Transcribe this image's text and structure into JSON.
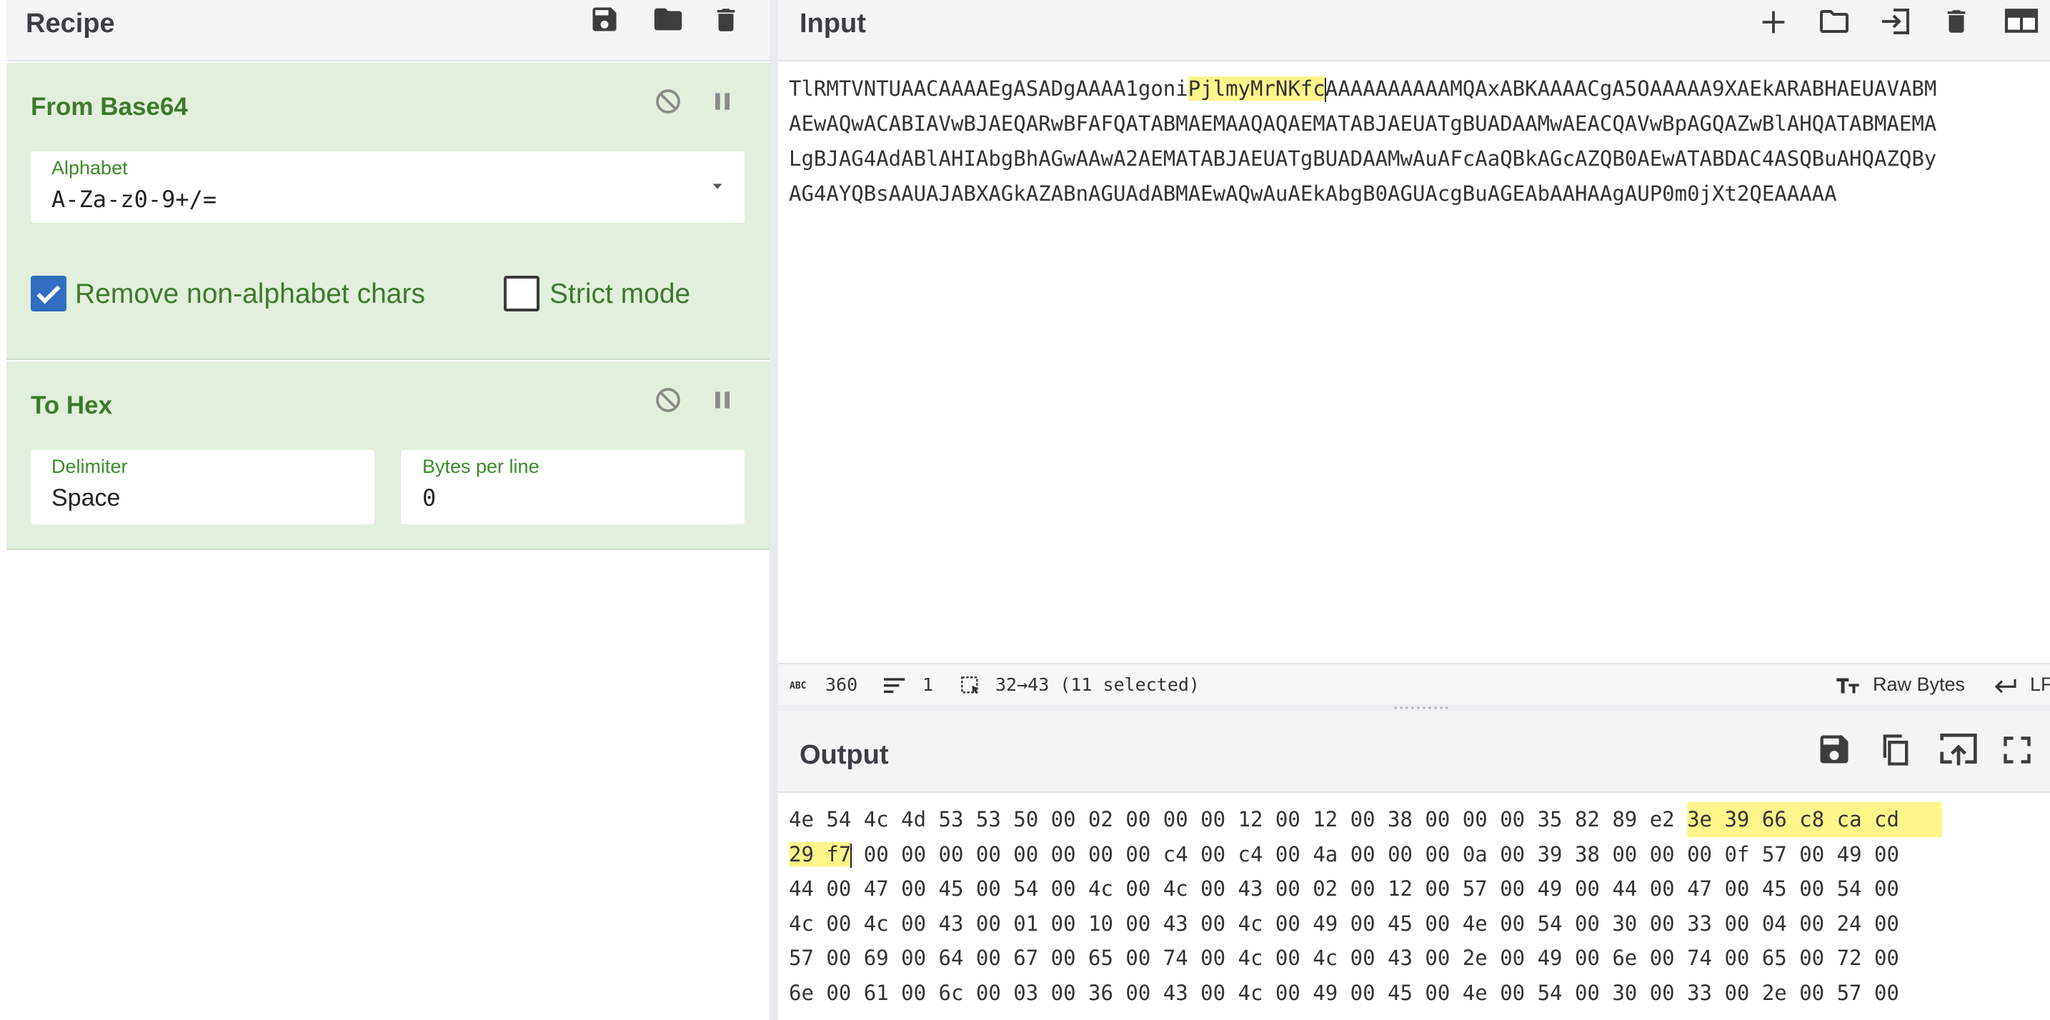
{
  "recipe": {
    "title": "Recipe",
    "toolbar_icons": [
      "save-icon",
      "folder-icon",
      "trash-icon"
    ],
    "operations": [
      {
        "name": "From Base64",
        "alphabet_label": "Alphabet",
        "alphabet_value": "A-Za-z0-9+/=",
        "remove_non_alphabet_label": "Remove non-alphabet chars",
        "remove_non_alphabet_checked": true,
        "strict_mode_label": "Strict mode",
        "strict_mode_checked": false
      },
      {
        "name": "To Hex",
        "delimiter_label": "Delimiter",
        "delimiter_value": "Space",
        "bytes_per_line_label": "Bytes per line",
        "bytes_per_line_value": "0"
      }
    ]
  },
  "input": {
    "title": "Input",
    "toolbar_icons": [
      "plus-icon",
      "folder-icon",
      "import-icon",
      "trash-icon",
      "layout-icon"
    ],
    "lines": [
      {
        "before": "TlRMTVNTUAACAAAAEgASADgAAAA1goni",
        "selected": "PjlmyMrNKfc",
        "after": "AAAAAAAAAAMQAxABKAAAACgA5OAAAAA9XAEkARABHAEUAVABM"
      },
      {
        "before": "AEwAQwACABIAVwBJAEQARwBFAFQATABMAEMAAQAQAEMATABJAEUATgBUADAAMwAEACQAVwBpAGQAZwBlAHQATABMAEMA",
        "selected": "",
        "after": ""
      },
      {
        "before": "LgBJAG4AdABlAHIAbgBhAGwAAwA2AEMATABJAEUATgBUADAAMwAuAFcAaQBkAGcAZQB0AEwATABDAC4ASQBuAHQAZQBy",
        "selected": "",
        "after": ""
      },
      {
        "before": "AG4AYQBsAAUAJABXAGkAZABnAGUAdABMAEwAQwAuAEkAbgB0AGUAcgBuAGEAbAAHAAgAUP0m0jXt2QEAAAAA",
        "selected": "",
        "after": ""
      }
    ],
    "status": {
      "length_icon": "abc-icon",
      "length": "360",
      "lines_icon": "lines-icon",
      "lines": "1",
      "selection_icon": "selection-icon",
      "selection": "32→43 (11 selected)",
      "encoding_icon": "text-size-icon",
      "encoding": "Raw Bytes",
      "eol_icon": "return-icon",
      "eol": "LF"
    }
  },
  "output": {
    "title": "Output",
    "toolbar_icons": [
      "save-icon",
      "copy-icon",
      "replace-input-icon",
      "maximize-icon"
    ],
    "line1_plain": "4e 54 4c 4d 53 53 50 00 02 00 00 00 12 00 12 00 38 00 00 00 35 82 89 e2 ",
    "line1_selected": "3e 39 66 c8 ca cd",
    "line2_selected": "29 f7",
    "line2_plain": " 00 00 00 00 00 00 00 00 c4 00 c4 00 4a 00 00 00 0a 00 39 38 00 00 00 0f 57 00 49 00",
    "lines": [
      "44 00 47 00 45 00 54 00 4c 00 4c 00 43 00 02 00 12 00 57 00 49 00 44 00 47 00 45 00 54 00",
      "4c 00 4c 00 43 00 01 00 10 00 43 00 4c 00 49 00 45 00 4e 00 54 00 30 00 33 00 04 00 24 00",
      "57 00 69 00 64 00 67 00 65 00 74 00 4c 00 4c 00 43 00 2e 00 49 00 6e 00 74 00 65 00 72 00",
      "6e 00 61 00 6c 00 03 00 36 00 43 00 4c 00 49 00 45 00 4e 00 54 00 30 00 33 00 2e 00 57 00"
    ]
  }
}
